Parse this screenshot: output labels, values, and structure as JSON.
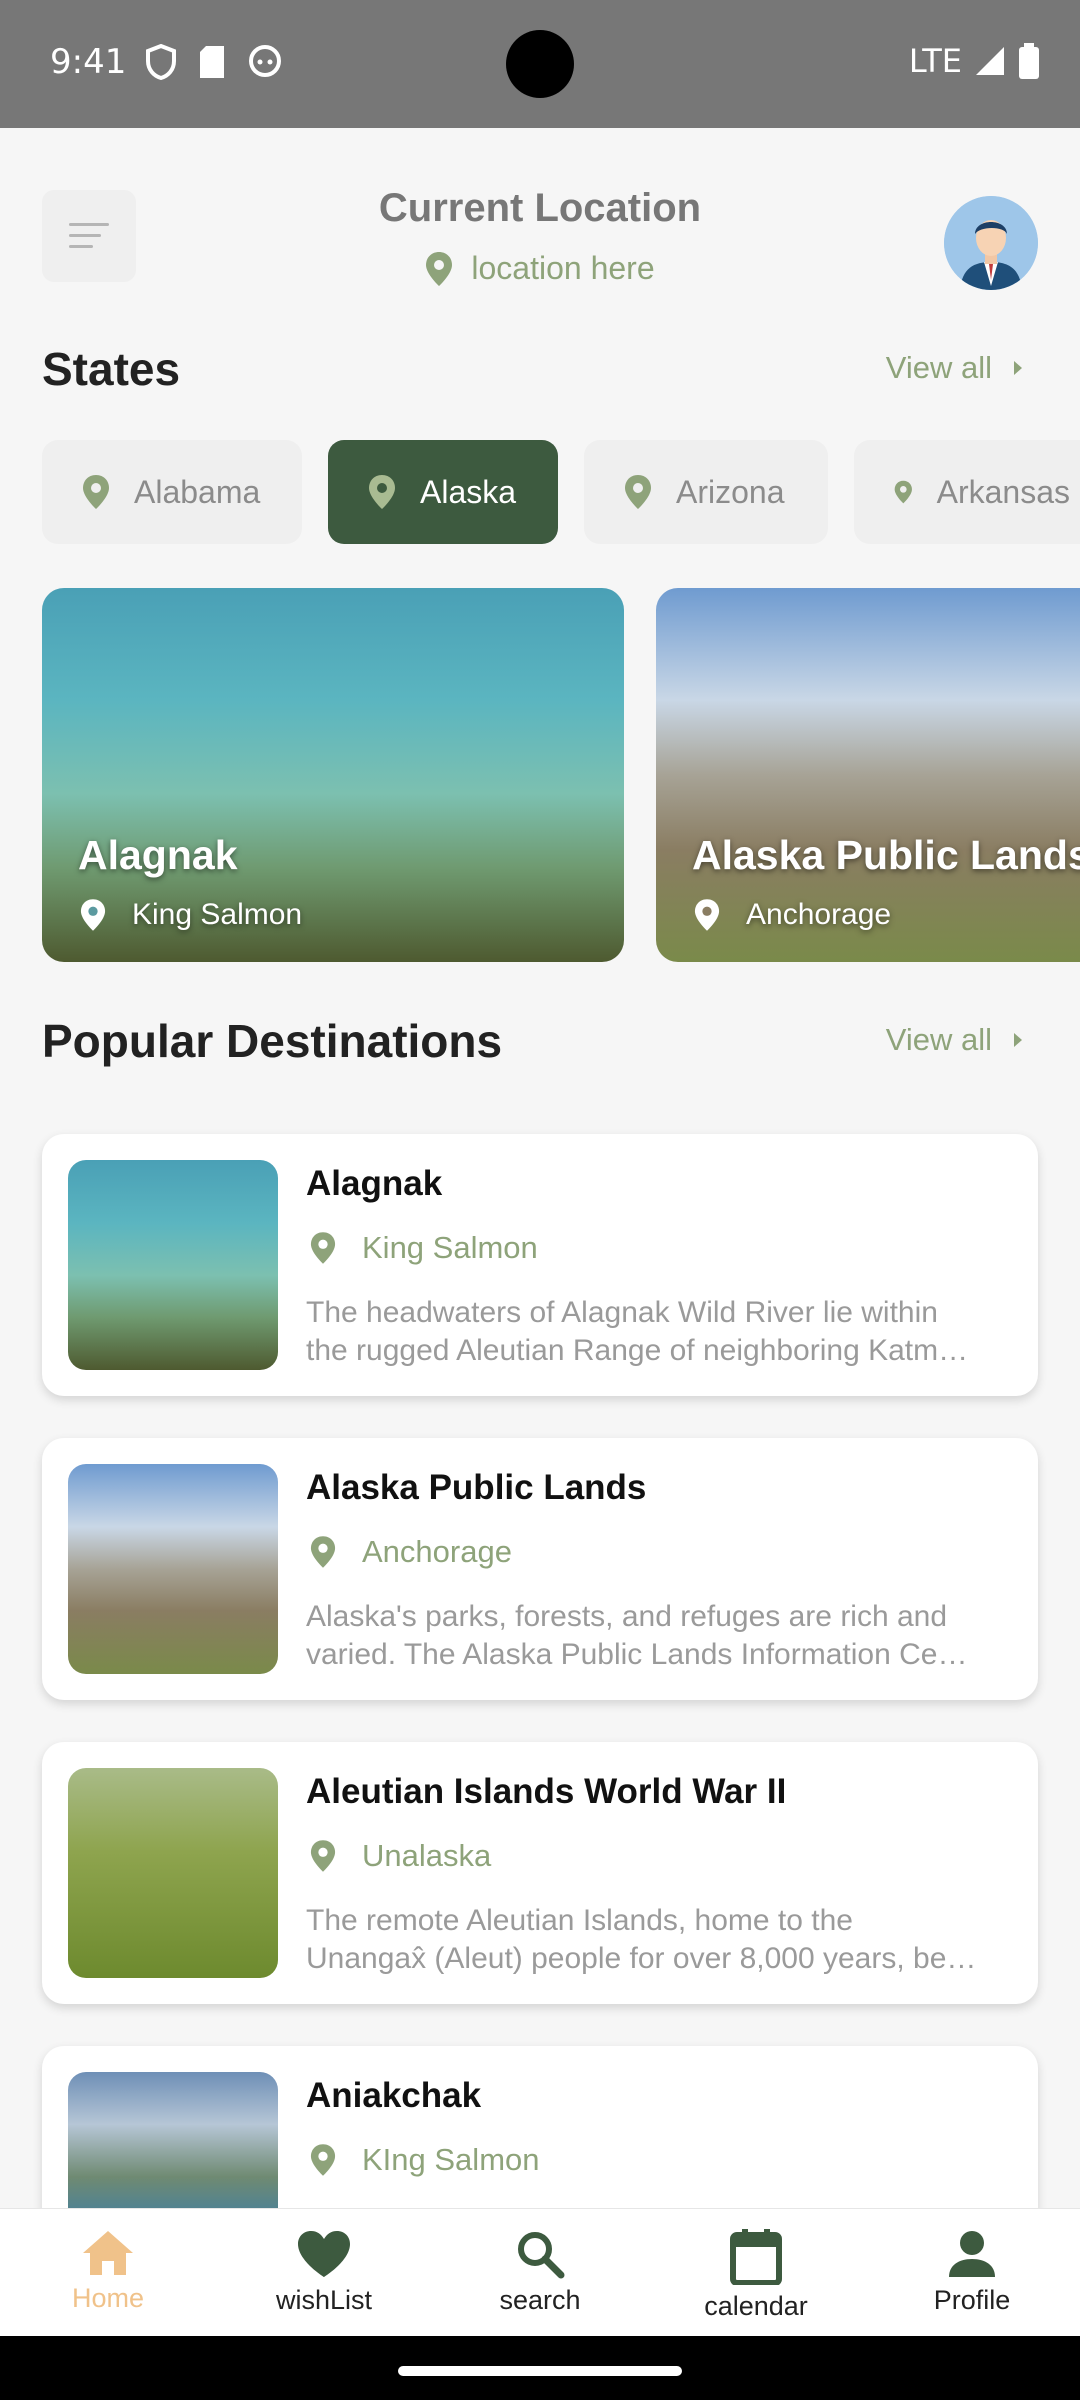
{
  "status_bar": {
    "time": "9:41",
    "network": "LTE"
  },
  "header": {
    "title": "Current Location",
    "location": "location here"
  },
  "states": {
    "title": "States",
    "view_all": "View all",
    "chips": [
      "Alabama",
      "Alaska",
      "Arizona",
      "Arkansas"
    ],
    "selected": "Alaska"
  },
  "parks": [
    {
      "name": "Alagnak",
      "location": "King Salmon"
    },
    {
      "name": "Alaska Public Lands",
      "location": "Anchorage"
    }
  ],
  "popular": {
    "title": "Popular Destinations",
    "view_all": "View all",
    "items": [
      {
        "name": "Alagnak",
        "location": "King Salmon",
        "desc1": "The headwaters of Alagnak Wild River lie within",
        "desc2": "the rugged Aleutian Range of neighboring Katm…"
      },
      {
        "name": "Alaska Public Lands",
        "location": "Anchorage",
        "desc1": "Alaska's parks, forests, and refuges are rich and",
        "desc2": "varied. The Alaska Public Lands Information Ce…"
      },
      {
        "name": "Aleutian Islands World War II",
        "location": "Unalaska",
        "desc1": "The remote Aleutian Islands, home to the",
        "desc2": "Unangax̂ (Aleut) people for over 8,000 years, be…"
      },
      {
        "name": "Aniakchak",
        "location": "KIng Salmon",
        "desc1": "",
        "desc2": ""
      }
    ]
  },
  "nav": [
    "Home",
    "wishList",
    "search",
    "calendar",
    "Profile"
  ],
  "colors": {
    "accent_green": "#3d5a3f",
    "muted_green": "#8ea37a",
    "nav_active": "#f0c28a"
  }
}
